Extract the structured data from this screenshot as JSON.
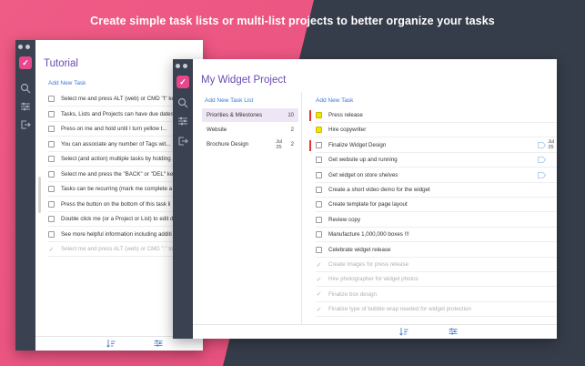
{
  "headline": "Create simple task lists or multi-list projects to better organize your tasks",
  "colors": {
    "accent_purple": "#6a4bb1",
    "link_blue": "#3a7bd5",
    "logo_pink": "#e8478b",
    "sidebar": "#3a4150",
    "highlight_yellow": "#f5e400",
    "priority_red": "#e33333"
  },
  "tutorial": {
    "title": "Tutorial",
    "add_task": "Add New Task",
    "tasks": [
      {
        "text": "Select me and press ALT (web) or CMD \"t\" key",
        "done": false
      },
      {
        "text": "Tasks, Lists and Projects can have due dates",
        "done": false
      },
      {
        "text": "Press on me and hold until I turn yellow t...",
        "done": false
      },
      {
        "text": "You can associate any number of Tags wit...",
        "done": false
      },
      {
        "text": "Select (and action) multiple tasks by holding a",
        "done": false
      },
      {
        "text": "Select me and press the \"BACK\" or \"DEL\" key",
        "done": false
      },
      {
        "text": "Tasks can be recurring (mark me complete a",
        "done": false
      },
      {
        "text": "Press the button on the bottom of this task li",
        "done": false
      },
      {
        "text": "Double click me (or a Project or List) to edit d",
        "done": false
      },
      {
        "text": "See more helpful information including additi",
        "done": false
      },
      {
        "text": "Select me and press ALT (web) or CMD \".\" to",
        "done": true
      }
    ]
  },
  "project": {
    "title": "My Widget Project",
    "add_list": "Add New Task List",
    "add_task": "Add New Task",
    "lists": [
      {
        "name": "Priorities & Milestones",
        "count": "10",
        "date_month": "",
        "date_day": "",
        "active": true
      },
      {
        "name": "Website",
        "count": "2",
        "date_month": "",
        "date_day": "",
        "active": false
      },
      {
        "name": "Brochure Design",
        "count": "2",
        "date_month": "Jul",
        "date_day": "25",
        "active": false
      }
    ],
    "tasks": [
      {
        "text": "Press release",
        "state": "yellow",
        "priority": true,
        "tag": false,
        "date_month": "",
        "date_day": ""
      },
      {
        "text": "Hire copywriter",
        "state": "yellow",
        "priority": false,
        "tag": false,
        "date_month": "",
        "date_day": ""
      },
      {
        "text": "Finalize Widget Design",
        "state": "open",
        "priority": true,
        "tag": true,
        "date_month": "Jul",
        "date_day": "25"
      },
      {
        "text": "Get website up and running",
        "state": "open",
        "priority": false,
        "tag": true,
        "date_month": "",
        "date_day": ""
      },
      {
        "text": "Get widget on store shelves",
        "state": "open",
        "priority": false,
        "tag": true,
        "date_month": "",
        "date_day": ""
      },
      {
        "text": "Create a short video demo for the widget",
        "state": "open",
        "priority": false,
        "tag": false,
        "date_month": "",
        "date_day": ""
      },
      {
        "text": "Create template for page layout",
        "state": "open",
        "priority": false,
        "tag": false,
        "date_month": "",
        "date_day": ""
      },
      {
        "text": "Review copy",
        "state": "open",
        "priority": false,
        "tag": false,
        "date_month": "",
        "date_day": ""
      },
      {
        "text": "Manufacture 1,000,000 boxes !!!",
        "state": "open",
        "priority": false,
        "tag": false,
        "date_month": "",
        "date_day": ""
      },
      {
        "text": "Celebrate widget release",
        "state": "open",
        "priority": false,
        "tag": false,
        "date_month": "",
        "date_day": ""
      },
      {
        "text": "Create images for press release",
        "state": "done",
        "priority": false,
        "tag": false,
        "date_month": "",
        "date_day": ""
      },
      {
        "text": "Hire photographer for widget photos",
        "state": "done",
        "priority": false,
        "tag": false,
        "date_month": "",
        "date_day": ""
      },
      {
        "text": "Finalize box design",
        "state": "done",
        "priority": false,
        "tag": false,
        "date_month": "",
        "date_day": ""
      },
      {
        "text": "Finalize type of bubble wrap needed for widget protection",
        "state": "done",
        "priority": false,
        "tag": false,
        "date_month": "",
        "date_day": ""
      }
    ]
  },
  "icons": {
    "logo": "check-logo-icon",
    "search": "search-icon",
    "filters": "sliders-icon",
    "signout": "sign-out-icon",
    "sort": "sort-icon"
  },
  "logo_glyph": "✓",
  "done_glyph": "✓"
}
